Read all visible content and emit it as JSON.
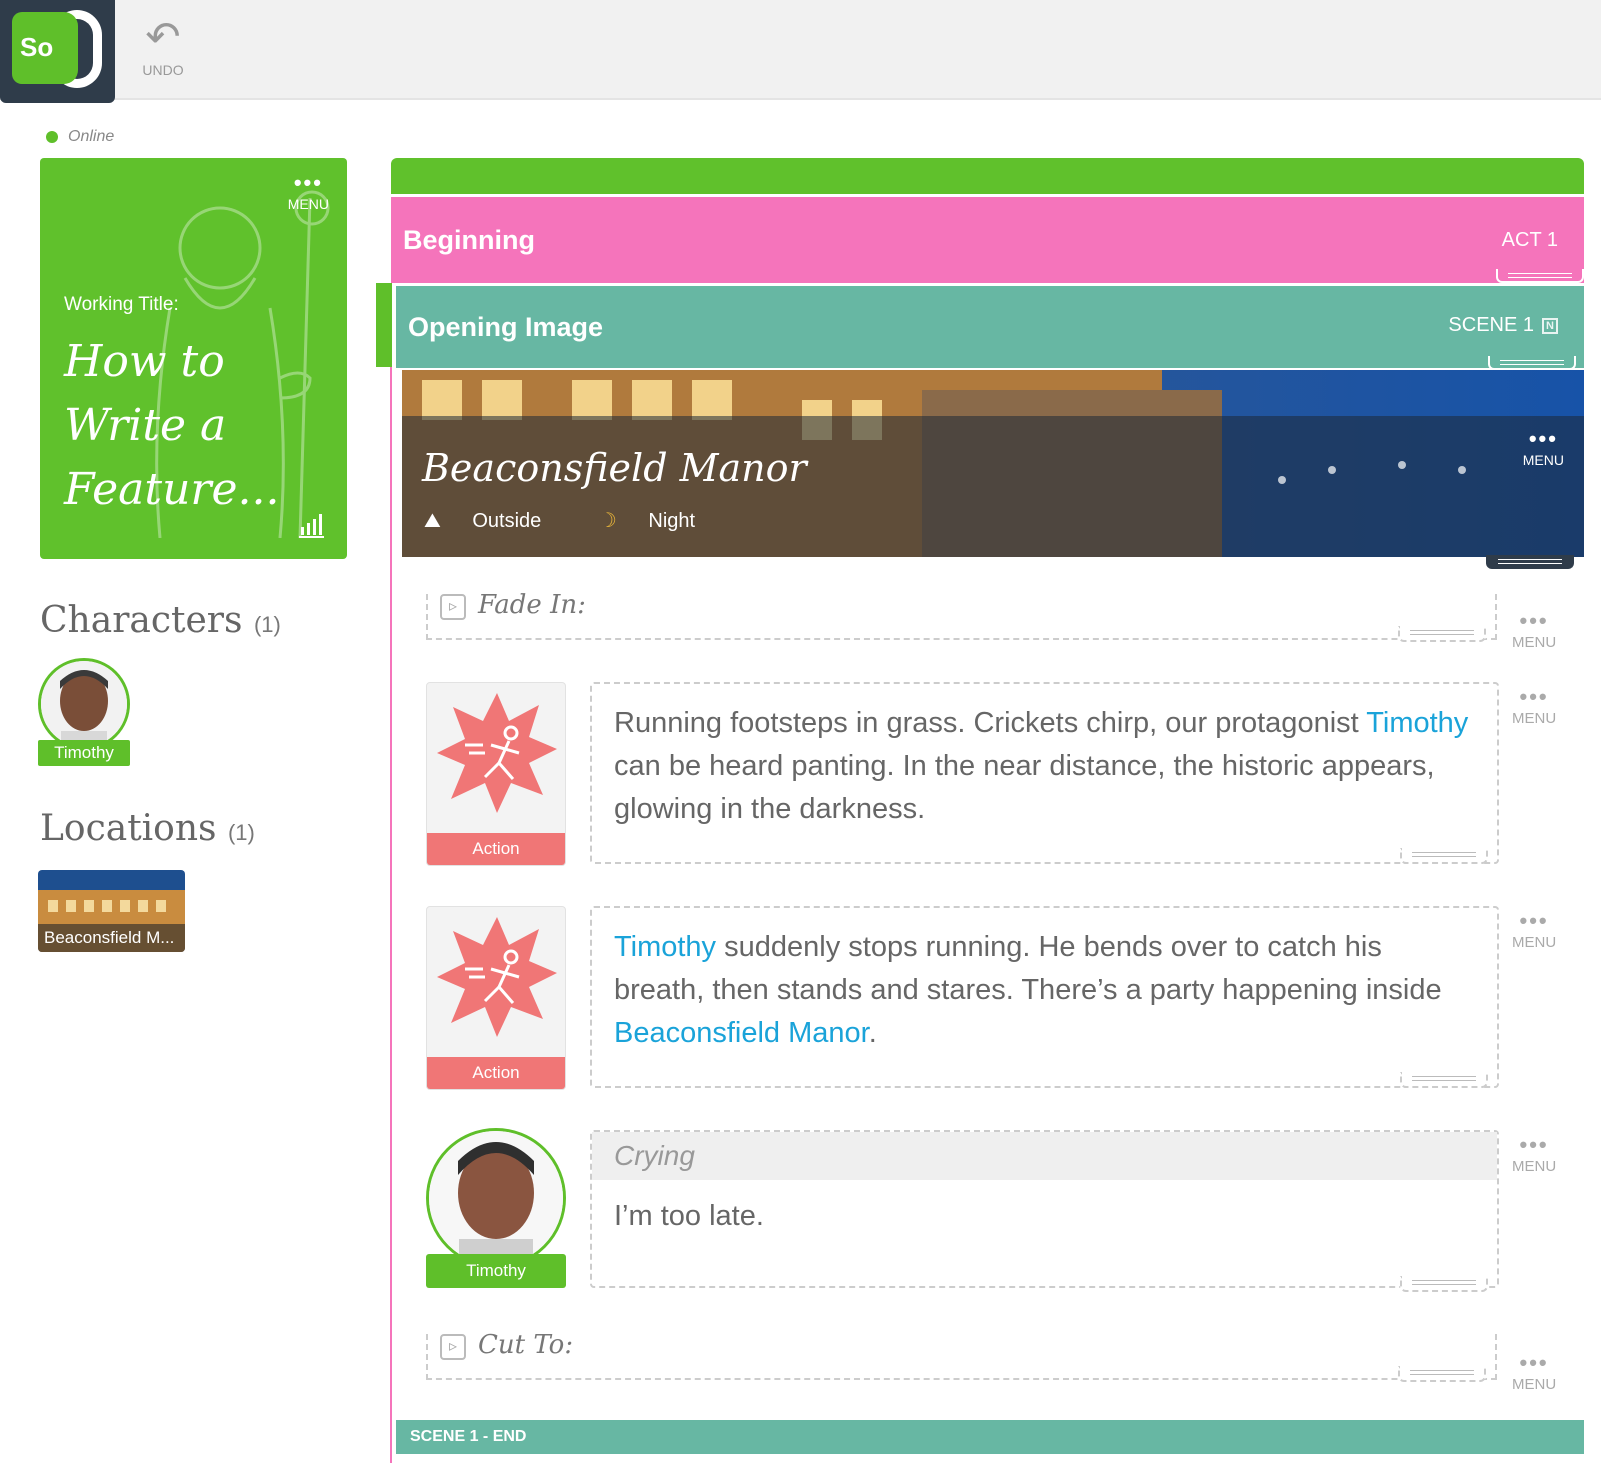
{
  "app": {
    "logo_text": "So",
    "undo_label": "UNDO"
  },
  "status": {
    "label": "Online",
    "color": "#5fbf2a"
  },
  "title_card": {
    "menu_label": "MENU",
    "working_title_label": "Working Title:",
    "title": "How to Write a Feature...",
    "color": "#60c12c"
  },
  "characters": {
    "heading": "Characters",
    "count": "(1)",
    "items": [
      {
        "name": "Timothy"
      }
    ]
  },
  "locations": {
    "heading": "Locations",
    "count": "(1)",
    "items": [
      {
        "name": "Beaconsfield M..."
      }
    ]
  },
  "act": {
    "title": "Beginning",
    "label": "ACT 1",
    "color": "#f574bb"
  },
  "scene": {
    "title": "Opening Image",
    "label": "SCENE 1",
    "note_icon": "N",
    "color": "#67b7a3",
    "end_label": "SCENE 1 - END"
  },
  "location_banner": {
    "name": "Beaconsfield Manor",
    "setting": "Outside",
    "time": "Night",
    "menu_label": "MENU"
  },
  "beats": [
    {
      "type": "transition",
      "text": "Fade In:",
      "menu_label": "MENU"
    },
    {
      "type": "action",
      "card_label": "Action",
      "menu_label": "MENU",
      "segments": [
        {
          "text": "Running footsteps in grass. Crickets chirp, our protagonist ",
          "mention": false
        },
        {
          "text": "Timothy",
          "mention": true
        },
        {
          "text": " can be heard panting. In the near distance, the historic appears, glowing in the darkness.",
          "mention": false
        }
      ]
    },
    {
      "type": "action",
      "card_label": "Action",
      "menu_label": "MENU",
      "segments": [
        {
          "text": "Timothy",
          "mention": true
        },
        {
          "text": " suddenly stops running. He bends over to catch his breath, then stands and stares. There’s a party happening inside ",
          "mention": false
        },
        {
          "text": "Beaconsfield Manor",
          "mention": true
        },
        {
          "text": ".",
          "mention": false
        }
      ]
    },
    {
      "type": "dialogue",
      "character": "Timothy",
      "parenthetical": "Crying",
      "line": "I’m too late.",
      "menu_label": "MENU"
    },
    {
      "type": "transition",
      "text": "Cut To:",
      "menu_label": "MENU"
    }
  ],
  "colors": {
    "accent_green": "#5fbf2a",
    "act_pink": "#f574bb",
    "scene_teal": "#67b7a3",
    "action_red": "#f07676",
    "mention_blue": "#1aa3d9"
  }
}
